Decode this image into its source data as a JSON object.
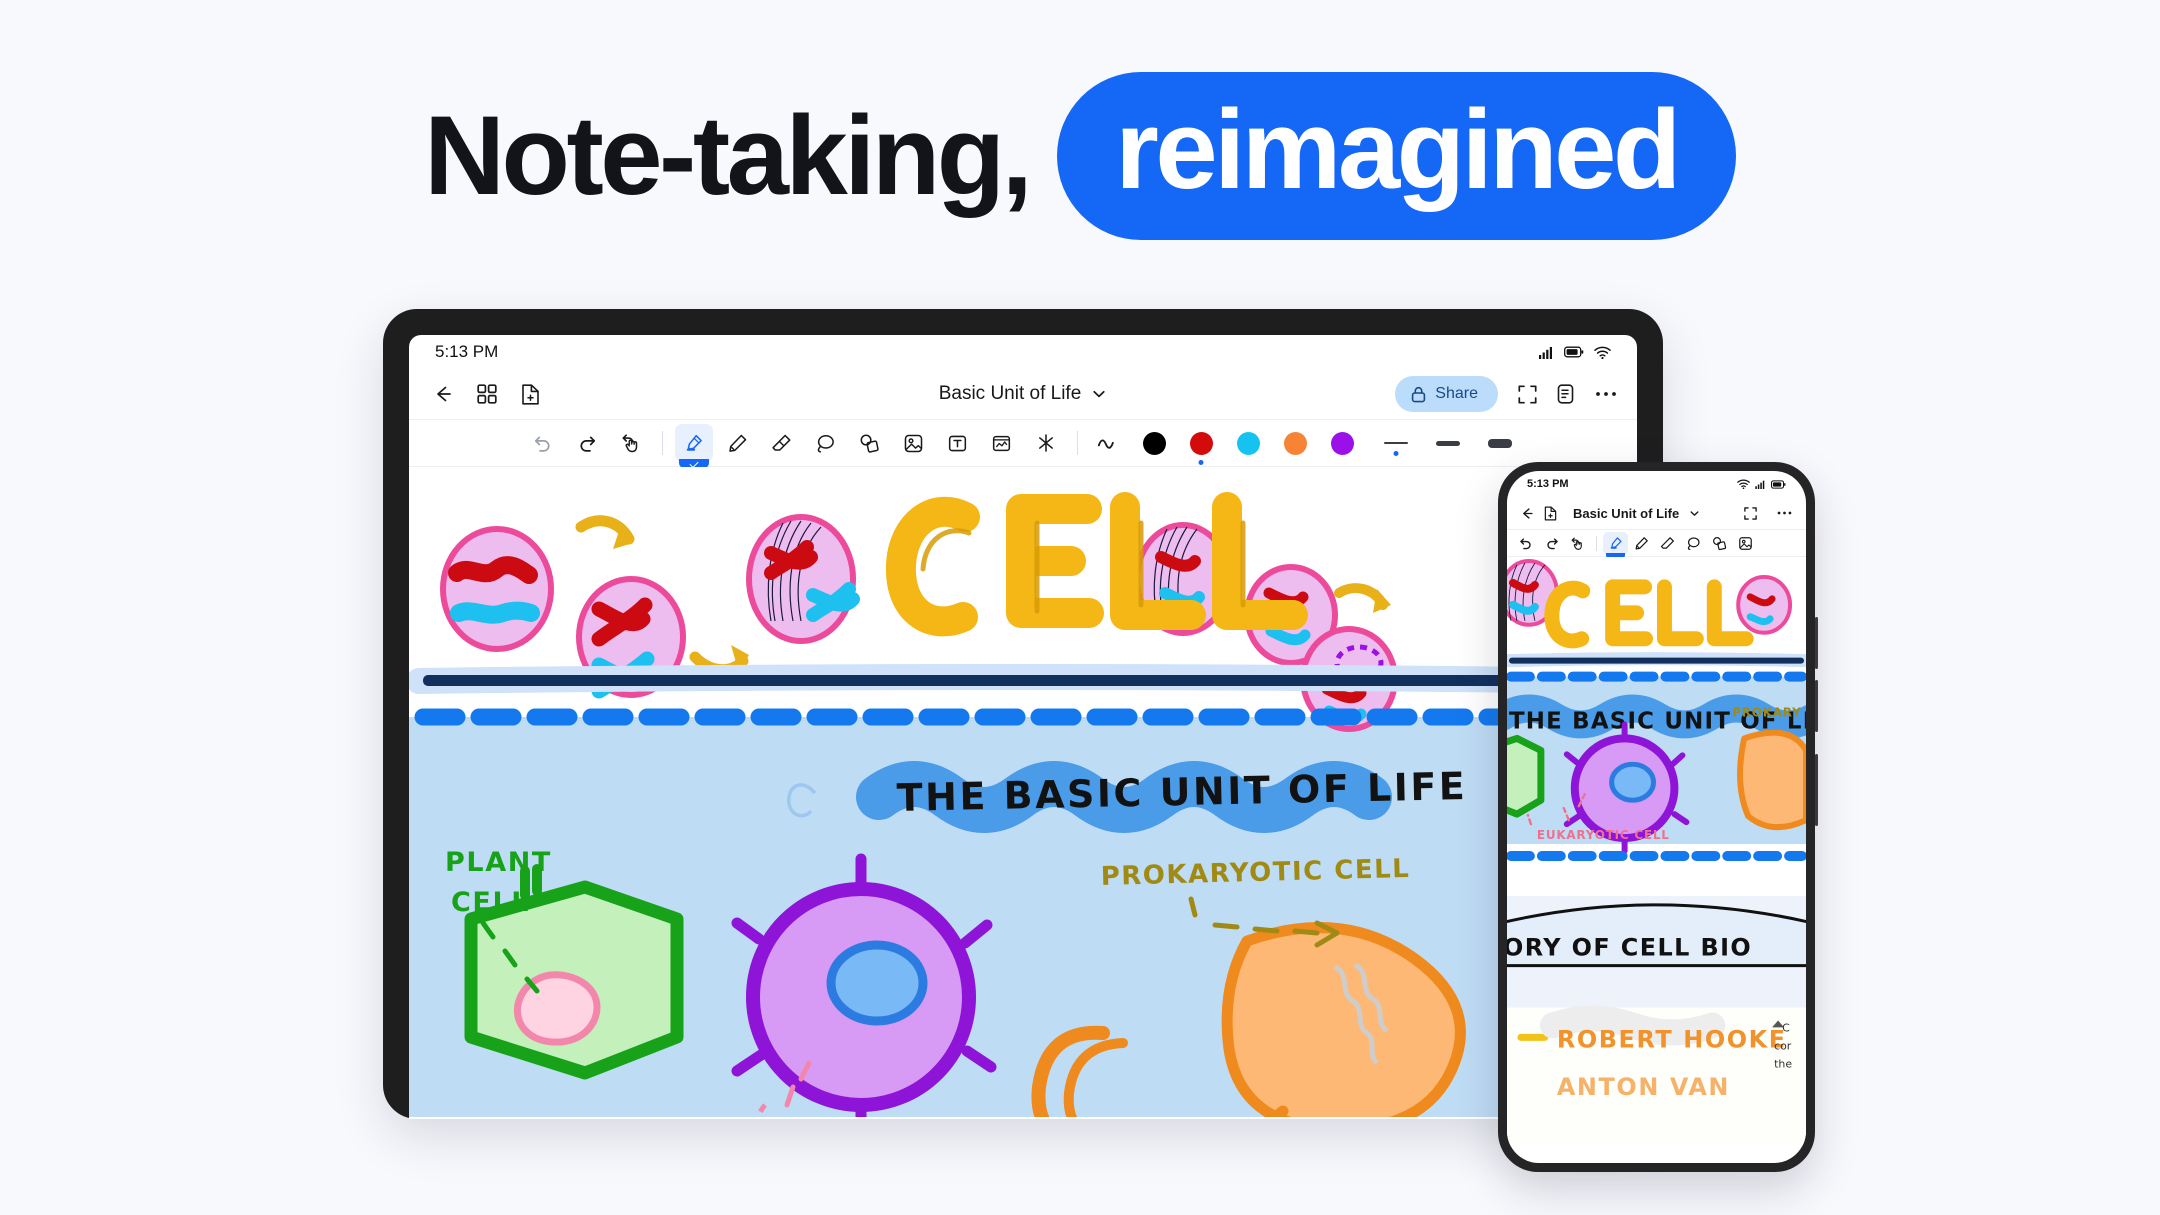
{
  "hero": {
    "headline": "Note-taking,",
    "pill_word": "reimagined",
    "pill_color": "#1567f5",
    "text_color": "#13131a",
    "background": "#f8f9fd"
  },
  "tablet": {
    "status_bar": {
      "time": "5:13 PM",
      "icons": [
        "cellular-signal-icon",
        "battery-icon",
        "wifi-icon"
      ]
    },
    "nav": {
      "back_label": "back-arrow-icon",
      "grid_label": "page-grid-icon",
      "new_page_label": "new-page-icon",
      "title": "Basic Unit of Life",
      "title_chevron": "chevron-down-icon",
      "share_label": "Share",
      "share_icon": "lock-icon",
      "share_bg": "#bcdcfb",
      "share_fg": "#1a4a85",
      "fullscreen_icon": "fullscreen-icon",
      "outline_icon": "document-outline-icon",
      "more_icon": "more-horizontal-icon"
    },
    "toolbar": {
      "history": [
        {
          "name": "undo-button",
          "icon": "undo-icon"
        },
        {
          "name": "redo-button",
          "icon": "redo-icon"
        },
        {
          "name": "gesture-undo-button",
          "icon": "hand-undo-icon"
        }
      ],
      "tools": [
        {
          "name": "highlighter-tool",
          "icon": "highlighter-icon",
          "selected": true
        },
        {
          "name": "pen-tool",
          "icon": "pen-icon",
          "selected": false
        },
        {
          "name": "eraser-tool",
          "icon": "eraser-icon",
          "selected": false
        },
        {
          "name": "lasso-tool",
          "icon": "lasso-icon",
          "selected": false
        },
        {
          "name": "shapes-tool",
          "icon": "shapes-icon",
          "selected": false
        },
        {
          "name": "image-tool",
          "icon": "image-icon",
          "selected": false
        },
        {
          "name": "text-tool",
          "icon": "text-box-icon",
          "selected": false
        },
        {
          "name": "sticky-note-tool",
          "icon": "sticky-note-icon",
          "selected": false
        },
        {
          "name": "ai-tool",
          "icon": "sparkle-icon",
          "selected": false
        }
      ],
      "style_toggle": {
        "name": "stroke-style-toggle",
        "icon": "wave-icon"
      },
      "colors": [
        {
          "name": "color-black",
          "hex": "#000000",
          "selected": false
        },
        {
          "name": "color-red",
          "hex": "#d30b0b",
          "selected": true
        },
        {
          "name": "color-cyan",
          "hex": "#16c3f0",
          "selected": false
        },
        {
          "name": "color-orange",
          "hex": "#f78434",
          "selected": false
        },
        {
          "name": "color-purple",
          "hex": "#9b10e8",
          "selected": false
        }
      ],
      "stroke_widths": [
        {
          "name": "stroke-thin",
          "px": 3,
          "selected": true
        },
        {
          "name": "stroke-medium",
          "px": 5,
          "selected": false
        },
        {
          "name": "stroke-thick",
          "px": 9,
          "selected": false
        }
      ]
    },
    "note": {
      "title_word": "CELL",
      "title_color": "#f5b716",
      "subtitle": "THE BASIC UNIT OF LIFE",
      "subtitle_highlight": "#4a9ce8",
      "labels": [
        {
          "name": "plant-cell-label",
          "text": "PLANT",
          "text2": "CELL",
          "color": "#17a21a"
        },
        {
          "name": "prokaryotic-cell-label",
          "text": "PROKARYOTIC CELL",
          "color": "#a08a14"
        }
      ],
      "band_color": "#bfdcf5",
      "divider_color": "#1479ef"
    }
  },
  "phone": {
    "status_bar": {
      "time": "5:13 PM",
      "icons": [
        "wifi-icon",
        "cellular-signal-icon",
        "battery-icon"
      ]
    },
    "nav": {
      "back_label": "back-arrow-icon",
      "new_page_label": "new-page-icon",
      "title": "Basic Unit of Life",
      "title_chevron": "chevron-down-icon",
      "fullscreen_icon": "fullscreen-icon",
      "more_icon": "more-horizontal-icon"
    },
    "toolbar": {
      "history": [
        {
          "name": "undo-button",
          "icon": "undo-icon"
        },
        {
          "name": "redo-button",
          "icon": "redo-icon"
        },
        {
          "name": "gesture-undo-button",
          "icon": "hand-undo-icon"
        }
      ],
      "tools": [
        {
          "name": "highlighter-tool",
          "icon": "highlighter-icon",
          "selected": true
        },
        {
          "name": "pen-tool",
          "icon": "pen-icon",
          "selected": false
        },
        {
          "name": "eraser-tool",
          "icon": "eraser-icon",
          "selected": false
        },
        {
          "name": "lasso-tool",
          "icon": "lasso-icon",
          "selected": false
        },
        {
          "name": "shapes-tool",
          "icon": "shapes-icon",
          "selected": false
        },
        {
          "name": "image-tool",
          "icon": "image-icon",
          "selected": false
        }
      ]
    },
    "note": {
      "title_word": "CELL",
      "subtitle": "THE BASIC UNIT OF LIFE",
      "labels": [
        {
          "name": "prokaryotic-cell-label",
          "text": "PROKARY",
          "color": "#a08a14"
        },
        {
          "name": "eukaryotic-cell-label",
          "text": "EUKARYOTIC CELL",
          "color": "#f0708f"
        }
      ],
      "section_heading": "ORY OF CELL BIO",
      "list_item": "ROBERT HOOKE",
      "list_item_color": "#f2922a",
      "side_note_lines": [
        "C",
        "cor",
        "the"
      ]
    }
  }
}
